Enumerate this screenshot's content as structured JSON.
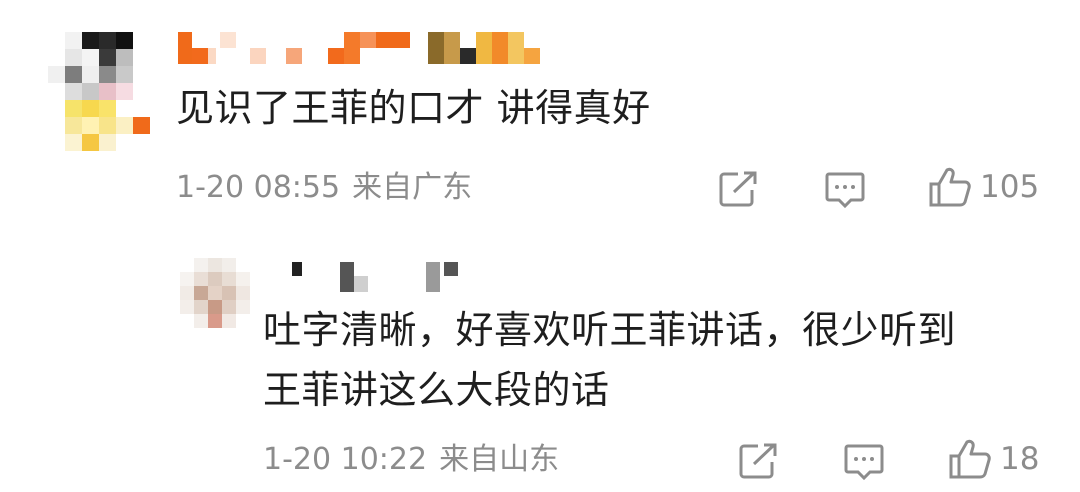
{
  "comments": [
    {
      "text": "见识了王菲的口才 讲得真好",
      "time": "1-20 08:55",
      "location": "来自广东",
      "likes": "105",
      "replies": [
        {
          "text": "吐字清晰，好喜欢听王菲讲话，很少听到\n王菲讲这么大段的话",
          "time": "1-20 10:22",
          "location": "来自山东",
          "likes": "18"
        }
      ]
    }
  ],
  "colors": {
    "text": "#1e1e1e",
    "meta": "#8c8c8c",
    "icon": "#8c8c8c",
    "background": "#ffffff"
  },
  "icons": {
    "share": "share-icon",
    "comment": "comment-icon",
    "like": "like-icon"
  }
}
